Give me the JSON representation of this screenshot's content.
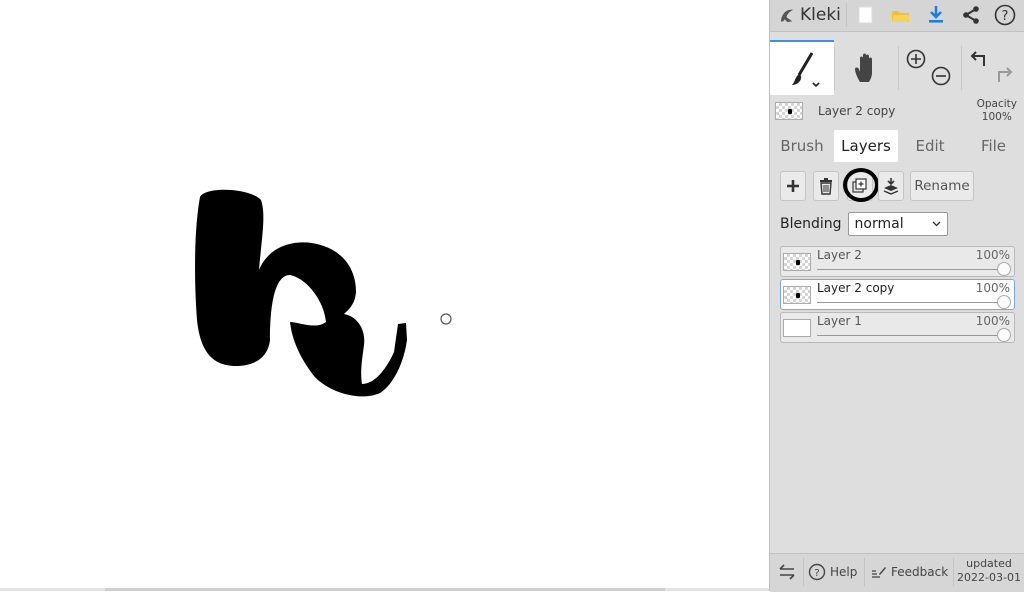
{
  "app": {
    "name": "Kleki"
  },
  "topbar": {
    "icons": [
      "kleki-logo-icon",
      "new-file-icon",
      "open-folder-icon",
      "download-icon",
      "share-icon",
      "help-icon"
    ],
    "accent": "#1e7fd8",
    "folder_color": "#f5c02a"
  },
  "tools": [
    "brush-tool-icon",
    "hand-tool-icon",
    "zoom-in-icon",
    "zoom-out-icon",
    "undo-icon",
    "redo-icon"
  ],
  "current_layer": {
    "name": "Layer 2 copy",
    "opacity_label": "Opacity",
    "opacity_value": "100%"
  },
  "tabs": [
    {
      "label": "Brush",
      "active": false
    },
    {
      "label": "Layers",
      "active": true
    },
    {
      "label": "Edit",
      "active": false
    },
    {
      "label": "File",
      "active": false
    }
  ],
  "layer_actions": {
    "icons": [
      "add-layer-icon",
      "delete-layer-icon",
      "duplicate-layer-icon",
      "merge-down-icon"
    ],
    "rename_label": "Rename"
  },
  "blending": {
    "label": "Blending",
    "value": "normal"
  },
  "layers": [
    {
      "name": "Layer 2",
      "opacity": "100%",
      "selected": false,
      "opacity_fraction": 1.0
    },
    {
      "name": "Layer 2 copy",
      "opacity": "100%",
      "selected": true,
      "opacity_fraction": 1.0
    },
    {
      "name": "Layer 1",
      "opacity": "100%",
      "selected": false,
      "opacity_fraction": 1.0
    }
  ],
  "footer": {
    "help_label": "Help",
    "feedback_label": "Feedback",
    "updated_label": "updated",
    "updated_date": "2022-03-01"
  }
}
